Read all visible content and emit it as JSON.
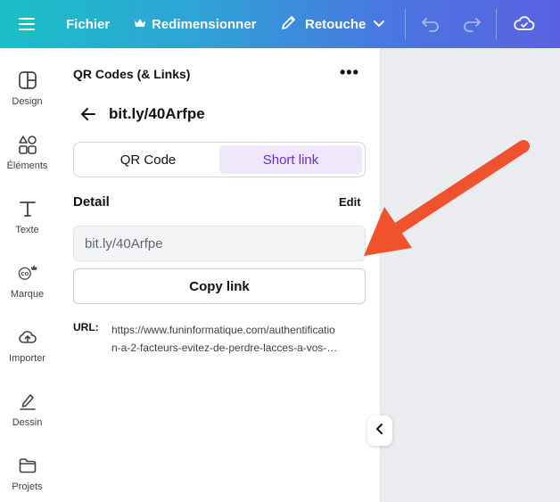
{
  "topbar": {
    "fichier": "Fichier",
    "resize": "Redimensionner",
    "retouche": "Retouche"
  },
  "rail": [
    {
      "label": "Design",
      "icon": "design-icon"
    },
    {
      "label": "Éléments",
      "icon": "elements-icon"
    },
    {
      "label": "Texte",
      "icon": "text-icon"
    },
    {
      "label": "Marque",
      "icon": "brand-icon"
    },
    {
      "label": "Importer",
      "icon": "upload-icon"
    },
    {
      "label": "Dessin",
      "icon": "draw-icon"
    },
    {
      "label": "Projets",
      "icon": "folder-icon"
    }
  ],
  "panel": {
    "title": "QR Codes (& Links)",
    "heading": "bit.ly/40Arfpe",
    "tabs": [
      "QR Code",
      "Short link"
    ],
    "active_tab": "Short link",
    "detail_label": "Detail",
    "edit_label": "Edit",
    "short_link_value": "bit.ly/40Arfpe",
    "copy_label": "Copy link",
    "url_label": "URL:",
    "url_line1": "https://www.funinformatique.com/authentificatio",
    "url_line2": "n-a-2-facteurs-evitez-de-perdre-lacces-a-vos-…"
  },
  "colors": {
    "accent": "#6a2ad6",
    "active_tab_bg": "#efe8fd",
    "annotation_arrow": "#f0522d"
  }
}
